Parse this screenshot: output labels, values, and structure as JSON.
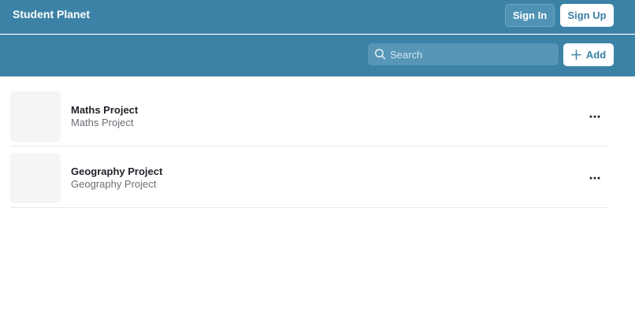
{
  "header": {
    "app_title": "Student Planet",
    "signin_label": "Sign In",
    "signup_label": "Sign Up"
  },
  "toolbar": {
    "search_placeholder": "Search",
    "search_icon": "search-icon",
    "add_label": "Add",
    "add_icon": "plus-icon"
  },
  "projects": [
    {
      "title": "Maths Project",
      "subtitle": "Maths Project"
    },
    {
      "title": "Geography Project",
      "subtitle": "Geography Project"
    }
  ],
  "colors": {
    "brand": "#3c82a6",
    "text": "#1f2328",
    "muted": "#6a6f75"
  }
}
